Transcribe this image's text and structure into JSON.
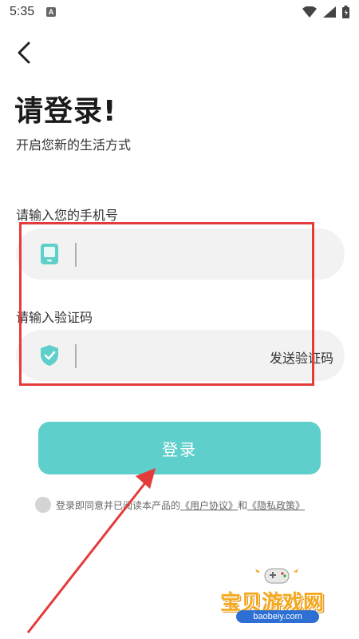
{
  "status_bar": {
    "time": "5:35",
    "icons": [
      "a-icon",
      "wifi-icon",
      "signal-icon",
      "battery-icon"
    ]
  },
  "header": {
    "back_icon": "chevron-left-icon"
  },
  "title": "请登录!",
  "subtitle": "开启您新的生活方式",
  "phone": {
    "label": "请输入您的手机号",
    "icon": "phone-icon",
    "value": ""
  },
  "code": {
    "label": "请输入验证码",
    "icon": "shield-check-icon",
    "value": "",
    "send_label": "发送验证码"
  },
  "login_button": "登录",
  "agreement": {
    "prefix": "登录即同意并已阅读本产品的",
    "user_agreement": "《用户协议》",
    "and": "和",
    "privacy_policy": "《隐私政策》"
  },
  "watermark": {
    "title": "宝贝游戏网",
    "url": "baobeiy.com"
  },
  "colors": {
    "accent": "#5ecfca",
    "highlight": "#e43b3b",
    "input_bg": "#f2f2f2",
    "watermark": "#f4a81d"
  }
}
